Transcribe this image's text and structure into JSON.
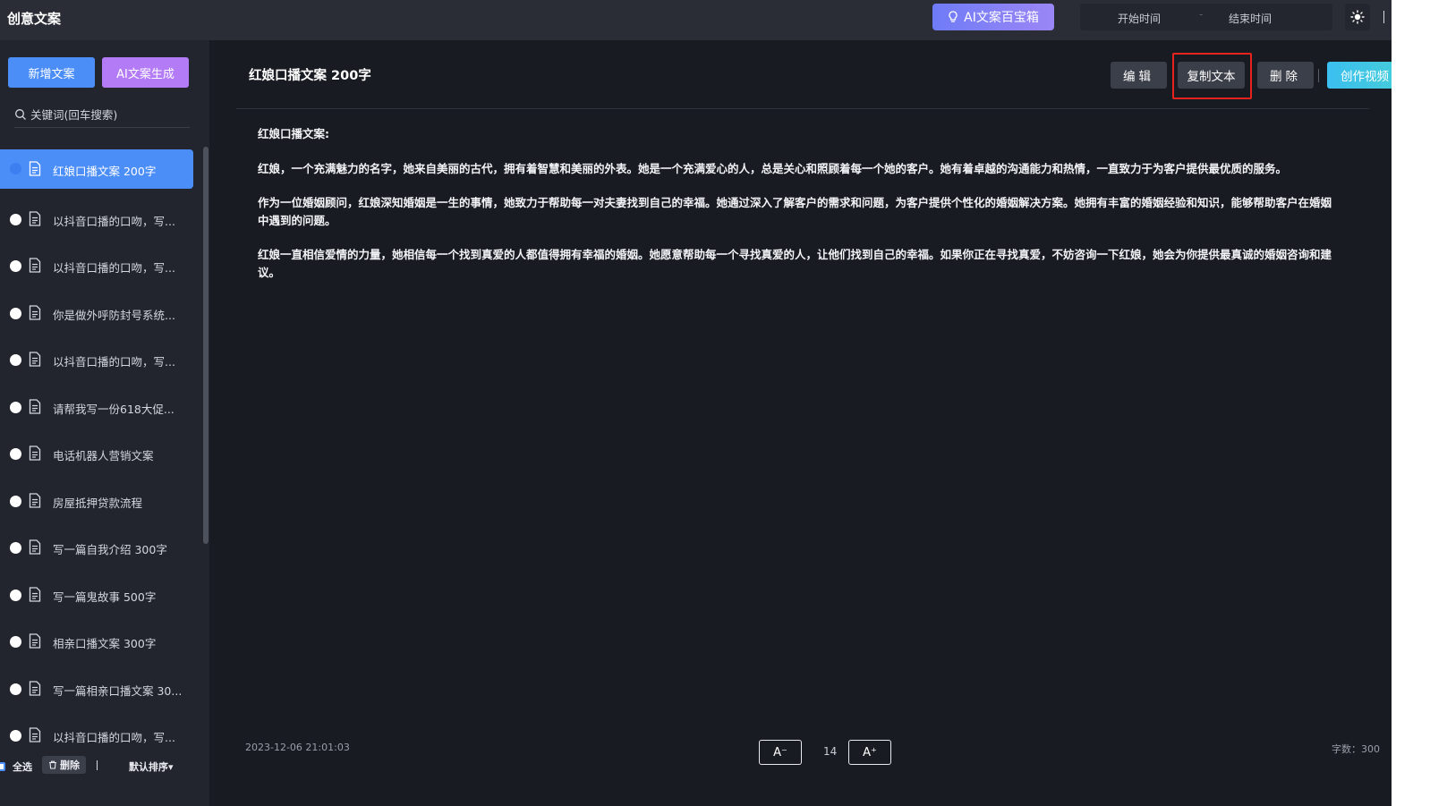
{
  "app": {
    "title": "创意文案"
  },
  "topbar": {
    "ai_box_label": "AI文案百宝箱",
    "start_placeholder": "开始时间",
    "separator": "-",
    "end_placeholder": "结束时间"
  },
  "sidebar": {
    "new_label": "新增文案",
    "ai_gen_label": "AI文案生成",
    "search_placeholder": "关键词(回车搜索)",
    "items": [
      {
        "label": "红娘口播文案 200字",
        "active": true
      },
      {
        "label": "以抖音口播的口吻，写..."
      },
      {
        "label": "以抖音口播的口吻，写..."
      },
      {
        "label": "你是做外呼防封号系统..."
      },
      {
        "label": "以抖音口播的口吻，写..."
      },
      {
        "label": "请帮我写一份618大促..."
      },
      {
        "label": "电话机器人营销文案"
      },
      {
        "label": "房屋抵押贷款流程"
      },
      {
        "label": "写一篇自我介绍 300字"
      },
      {
        "label": "写一篇鬼故事 500字"
      },
      {
        "label": "相亲口播文案 300字"
      },
      {
        "label": "写一篇相亲口播文案 30..."
      },
      {
        "label": "以抖音口播的口吻，写..."
      }
    ],
    "select_all_label": "全选",
    "delete_label": "删除",
    "sort_label": "默认排序"
  },
  "main": {
    "title": "红娘口播文案 200字",
    "actions": {
      "edit": "编辑",
      "copy": "复制文本",
      "delete": "删除",
      "video": "创作视频"
    },
    "paragraphs": [
      "红娘口播文案:",
      "红娘，一个充满魅力的名字，她来自美丽的古代，拥有着智慧和美丽的外表。她是一个充满爱心的人，总是关心和照顾着每一个她的客户。她有着卓越的沟通能力和热情，一直致力于为客户提供最优质的服务。",
      "作为一位婚姻顾问，红娘深知婚姻是一生的事情，她致力于帮助每一对夫妻找到自己的幸福。她通过深入了解客户的需求和问题，为客户提供个性化的婚姻解决方案。她拥有丰富的婚姻经验和知识，能够帮助客户在婚姻中遇到的问题。",
      "红娘一直相信爱情的力量，她相信每一个找到真爱的人都值得拥有幸福的婚姻。她愿意帮助每一个寻找真爱的人，让他们找到自己的幸福。如果你正在寻找真爱，不妨咨询一下红娘，她会为你提供最真诚的婚姻咨询和建议。"
    ],
    "footer": {
      "date": "2023-12-06 21:01:03",
      "font_dec": "A⁻",
      "font_size": "14",
      "font_inc": "A⁺",
      "word_count": "字数：300"
    }
  },
  "colors": {
    "accent_blue": "#4b8ef8",
    "accent_purple": "#b37bf5",
    "highlight_red": "#e8231e",
    "video_cyan": "#3bbff0"
  }
}
